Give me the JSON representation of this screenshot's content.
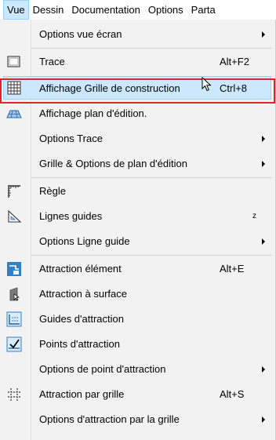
{
  "menubar": {
    "items": [
      "Vue",
      "Dessin",
      "Documentation",
      "Options",
      "Parta"
    ]
  },
  "menu": {
    "items": [
      {
        "label": "Options vue écran",
        "submenu": true
      },
      {
        "label": "Trace",
        "shortcut": "Alt+F2",
        "icon": "trace-window-icon"
      },
      {
        "label": "Affichage Grille de construction",
        "shortcut": "Ctrl+8",
        "icon": "construction-grid-icon",
        "highlighted": true
      },
      {
        "label": "Affichage plan d'édition.",
        "icon": "edit-plane-icon"
      },
      {
        "label": "Options Trace",
        "submenu": true
      },
      {
        "label": "Grille & Options de plan d'édition",
        "submenu": true
      },
      {
        "label": "Règle",
        "icon": "ruler-icon"
      },
      {
        "label": "Lignes guides",
        "shortcut": "z",
        "icon": "guide-lines-icon"
      },
      {
        "label": "Options Ligne guide",
        "submenu": true
      },
      {
        "label": "Attraction élément",
        "shortcut": "Alt+E",
        "icon": "element-snap-icon"
      },
      {
        "label": "Attraction à surface",
        "icon": "surface-snap-icon"
      },
      {
        "label": "Guides d'attraction",
        "icon": "snap-guides-icon"
      },
      {
        "label": "Points d'attraction",
        "icon": "snap-points-icon"
      },
      {
        "label": "Options de point d'attraction",
        "submenu": true
      },
      {
        "label": "Attraction par grille",
        "shortcut": "Alt+S",
        "icon": "grid-snap-icon"
      },
      {
        "label": "Options d'attraction par la grille",
        "submenu": true
      }
    ]
  },
  "colors": {
    "highlight_bg": "#cce8ff",
    "highlight_border": "#99d1ff",
    "annotation_red": "#e0242b",
    "menu_bg": "#f2f2f2"
  }
}
